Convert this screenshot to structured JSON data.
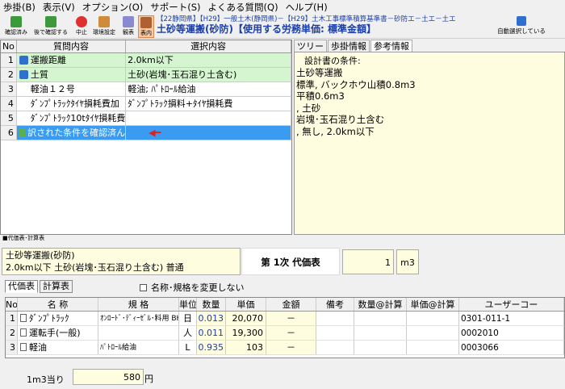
{
  "menu": [
    "歩掛(B)",
    "表示(V)",
    "オプション(O)",
    "サポート(S)",
    "よくある質問(Q)",
    "ヘルプ(H)"
  ],
  "toolbar": {
    "confirmed": "確認済み",
    "confirm_later": "後で確認する",
    "stop": "中止",
    "env": "環境設定",
    "view": "観表",
    "table": "表内",
    "auto_select": "自動選択している"
  },
  "info": {
    "line1": "【22静岡県】【H29】一般土木(静岡県)－【H29】土木工事標準積算基準書－砂防エ－土エ－土エ",
    "line2": "土砂等運搬(砂防)【使用する労務単価: 標準金額】"
  },
  "questions": {
    "headers": [
      "No",
      "質問内容",
      "選択内容"
    ],
    "rows": [
      {
        "no": "1",
        "q": "運搬距離",
        "a": "2.0km以下"
      },
      {
        "no": "2",
        "q": "土質",
        "a": "土砂(岩塊･玉石混り土含む)"
      },
      {
        "no": "3",
        "q": "軽油１２号",
        "a": "軽油; ﾊﾟﾄﾛｰﾙ給油"
      },
      {
        "no": "4",
        "q": "ﾀﾞﾝﾌﾟﾄﾗｯｸﾀｲﾔ損耗費加",
        "a": "ﾀﾞﾝﾌﾟﾄﾗｯｸ損料+ﾀｲﾔ損耗費"
      },
      {
        "no": "5",
        "q": "ﾀﾞﾝﾌﾟﾄﾗｯｸ10tﾀｲﾔ損耗費普通",
        "a": ""
      },
      {
        "no": "6",
        "q": "訳された条件を確認済ん",
        "a": ""
      }
    ]
  },
  "right": {
    "tabs": [
      "ツリー",
      "歩掛情報",
      "参考情報"
    ],
    "title": "設計書の条件:",
    "conditions": "土砂等運搬\n標準, バックホウ山積0.8m3\n平積0.6m3\n, 土砂\n岩塊･玉石混り土含む\n, 無し, 2.0km以下"
  },
  "section_label": "■代価表･計算表",
  "summary": {
    "line1": "土砂等運搬(砂防)",
    "line2": "2.0km以下 土砂(岩塊･玉石混り土含む) 普通",
    "daika": "第 1次 代価表",
    "qty": "1",
    "unit": "m3"
  },
  "lower_tabs": [
    "代価表",
    "計算表"
  ],
  "change_name_label": "名称･規格を変更しない",
  "cost_table": {
    "headers": [
      "No",
      "名 称",
      "規 格",
      "単位",
      "数量",
      "単価",
      "金額",
      "備考",
      "数量@計算",
      "単価@計算",
      "ユーザーコー"
    ],
    "rows": [
      {
        "no": "1",
        "name": "ﾀﾞﾝﾌﾟﾄﾗｯｸ",
        "spec": "ｵﾝﾛｰﾄﾞ･ﾃﾞｨｰｾﾞﾙ･料用 BH",
        "unit": "日",
        "qty": "0.013",
        "price": "20,070",
        "amount": "－",
        "code": "0301-011-1"
      },
      {
        "no": "2",
        "name": "運転手(一般)",
        "spec": "",
        "unit": "人",
        "qty": "0.011",
        "price": "19,300",
        "amount": "－",
        "code": "0002010"
      },
      {
        "no": "3",
        "name": "軽油",
        "spec": "ﾊﾟﾄﾛｰﾙ給油",
        "unit": "L",
        "qty": "0.935",
        "price": "103",
        "amount": "－",
        "code": "0003066"
      }
    ]
  },
  "per_unit": {
    "label": "1m3当り",
    "value": "580",
    "yen": "円"
  }
}
